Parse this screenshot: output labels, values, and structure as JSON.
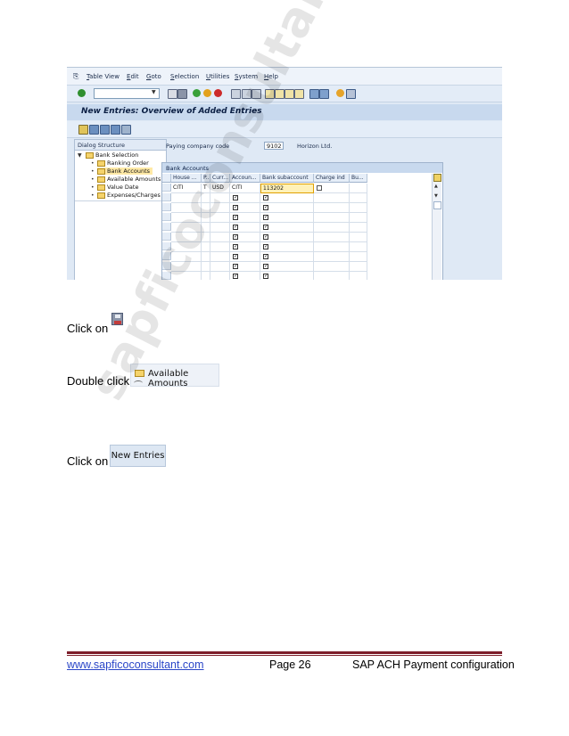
{
  "sap": {
    "menu": [
      "Table View",
      "Edit",
      "Goto",
      "Selection",
      "Utilities",
      "System",
      "Help"
    ],
    "page_title": "New Entries: Overview of Added Entries",
    "dialog_structure": {
      "heading": "Dialog Structure",
      "items": [
        "Bank Selection",
        "Ranking Order",
        "Bank Accounts",
        "Available Amounts",
        "Value Date",
        "Expenses/Charges"
      ]
    },
    "paying_company_code_label": "Paying company code",
    "paying_company_code": "9102",
    "company_name": "Horizon Ltd.",
    "table": {
      "title": "Bank Accounts",
      "columns": [
        "House ...",
        "P...",
        "Curr...",
        "Accoun...",
        "Bank subaccount",
        "Charge ind",
        "Bu..."
      ],
      "first_row": [
        "CITI",
        "T",
        "USD",
        "CITI",
        "113202",
        "",
        ""
      ]
    }
  },
  "instructions": {
    "click_on_1": "Click on",
    "double_click": "Double click",
    "available_amounts": "Available Amounts",
    "click_on_2": "Click on",
    "new_entries": "New Entries"
  },
  "watermark": "sapficoconsultant",
  "footer": {
    "link": "www.sapficoconsultant.com",
    "page": "Page 26",
    "title": "SAP ACH Payment configuration"
  }
}
